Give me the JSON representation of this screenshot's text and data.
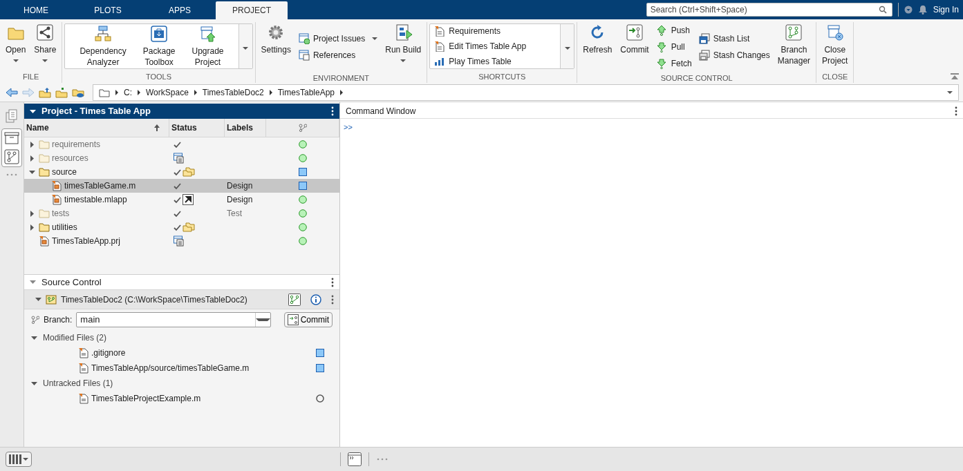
{
  "tabs": [
    {
      "label": "HOME",
      "selected": false
    },
    {
      "label": "PLOTS",
      "selected": false
    },
    {
      "label": "APPS",
      "selected": false
    },
    {
      "label": "PROJECT",
      "selected": true
    }
  ],
  "search": {
    "placeholder": "Search (Ctrl+Shift+Space)"
  },
  "sign_in": "Sign In",
  "toolstrip": [
    {
      "title": "FILE",
      "items": [
        {
          "kind": "large",
          "lines": [
            "Open"
          ],
          "menu": true
        },
        {
          "kind": "large",
          "lines": [
            "Share"
          ],
          "menu": true
        }
      ]
    },
    {
      "title": "TOOLS",
      "items": [
        {
          "kind": "gallery",
          "entries": [
            {
              "kind": "large",
              "lines": [
                "Dependency",
                "Analyzer"
              ]
            },
            {
              "kind": "large",
              "lines": [
                "Package",
                "Toolbox"
              ]
            },
            {
              "kind": "large",
              "lines": [
                "Upgrade",
                "Project"
              ]
            }
          ]
        }
      ]
    },
    {
      "title": "ENVIRONMENT",
      "items": [
        {
          "kind": "large",
          "lines": [
            "Settings"
          ],
          "menu": false
        },
        {
          "kind": "stack",
          "entries": [
            {
              "label": "Project Issues",
              "menu": true
            },
            {
              "label": "References",
              "menu": false
            }
          ]
        },
        {
          "kind": "large",
          "lines": [
            "Run Build"
          ],
          "menu": true
        }
      ]
    },
    {
      "title": "SHORTCUTS",
      "items": [
        {
          "kind": "gallery",
          "entries": [
            {
              "kind": "small",
              "lines": [
                "Requirements"
              ]
            },
            {
              "kind": "small",
              "lines": [
                "Edit Times Table App"
              ]
            },
            {
              "kind": "small",
              "lines": [
                "Play Times Table"
              ]
            }
          ]
        }
      ]
    },
    {
      "title": "SOURCE CONTROL",
      "items": [
        {
          "kind": "large",
          "lines": [
            "Refresh"
          ],
          "menu": false
        },
        {
          "kind": "large",
          "lines": [
            "Commit"
          ],
          "menu": false
        },
        {
          "kind": "stack",
          "entries": [
            {
              "label": "Push",
              "menu": false
            },
            {
              "label": "Pull",
              "menu": false
            },
            {
              "label": "Fetch",
              "menu": false
            }
          ]
        },
        {
          "kind": "stack",
          "entries": [
            {
              "label": "Stash List",
              "menu": false
            },
            {
              "label": "Stash Changes",
              "menu": false
            }
          ]
        },
        {
          "kind": "large",
          "lines": [
            "Branch",
            "Manager"
          ],
          "menu": false
        }
      ]
    },
    {
      "title": "CLOSE",
      "items": [
        {
          "kind": "large",
          "lines": [
            "Close",
            "Project"
          ],
          "menu": false
        }
      ]
    }
  ],
  "address": {
    "path": [
      "C:",
      "WorkSpace",
      "TimesTableDoc2",
      "TimesTableApp"
    ]
  },
  "project": {
    "title": "Project - Times Table App",
    "columns": [
      "Name",
      "Status",
      "Labels"
    ],
    "rows": [
      {
        "kind": "folder",
        "name": "requirements",
        "expanded": false,
        "dimmed": true,
        "checked": true,
        "reference": false,
        "folder_badge": false,
        "shortcut_badge": false,
        "modified": false,
        "selected": false
      },
      {
        "kind": "folder",
        "name": "resources",
        "expanded": false,
        "dimmed": true,
        "checked": false,
        "reference": true,
        "folder_badge": false,
        "shortcut_badge": false,
        "modified": false,
        "selected": false
      },
      {
        "kind": "folder",
        "name": "source",
        "expanded": true,
        "dimmed": false,
        "checked": true,
        "reference": false,
        "folder_badge": true,
        "shortcut_badge": false,
        "modified": true,
        "selected": false,
        "children": [
          {
            "kind": "file",
            "name": "timesTableGame.m",
            "dimmed": false,
            "checked": true,
            "reference": false,
            "folder_badge": false,
            "shortcut_badge": false,
            "label": "Design",
            "modified": true,
            "selected": true
          },
          {
            "kind": "file",
            "name": "timestable.mlapp",
            "dimmed": false,
            "checked": true,
            "reference": false,
            "folder_badge": false,
            "shortcut_badge": true,
            "label": "Design",
            "modified": false,
            "selected": false
          }
        ]
      },
      {
        "kind": "folder",
        "name": "tests",
        "expanded": false,
        "dimmed": true,
        "checked": true,
        "reference": false,
        "folder_badge": false,
        "shortcut_badge": false,
        "label": "Test",
        "modified": false,
        "selected": false
      },
      {
        "kind": "folder",
        "name": "utilities",
        "expanded": false,
        "dimmed": false,
        "checked": true,
        "reference": false,
        "folder_badge": true,
        "shortcut_badge": false,
        "modified": false,
        "selected": false
      },
      {
        "kind": "file",
        "name": "TimesTableApp.prj",
        "dimmed": false,
        "checked": false,
        "reference": true,
        "folder_badge": false,
        "shortcut_badge": false,
        "modified": false,
        "selected": false
      }
    ]
  },
  "source_control": {
    "title": "Source Control",
    "repository": "TimesTableDoc2 (C:\\WorkSpace\\TimesTableDoc2)",
    "branch_label": "Branch:",
    "branch": "main",
    "commit": "Commit",
    "groups": [
      {
        "title": "Modified Files (2)",
        "expanded": true,
        "files": [
          {
            "name": ".gitignore",
            "untracked": false
          },
          {
            "name": "TimesTableApp/source/timesTableGame.m",
            "untracked": false
          }
        ]
      },
      {
        "title": "Untracked Files (1)",
        "expanded": true,
        "files": [
          {
            "name": "TimesTableProjectExample.m",
            "untracked": true
          }
        ]
      }
    ]
  },
  "command_window": {
    "title": "Command Window",
    "prompt": ">>"
  }
}
